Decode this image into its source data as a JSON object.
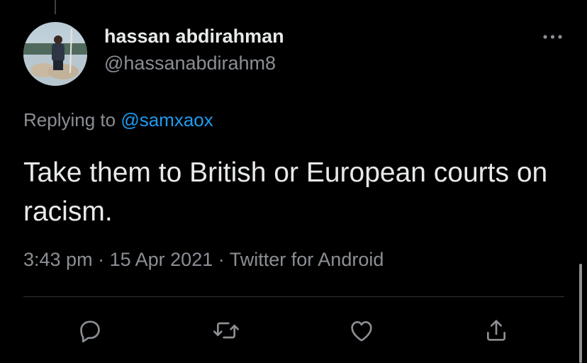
{
  "tweet": {
    "author": {
      "display_name": "hassan abdirahman",
      "handle": "@hassanabdirahm8",
      "avatar_icon": "profile-photo"
    },
    "reply_context": {
      "prefix": "Replying to",
      "mention": "@samxaox"
    },
    "text": "Take them to British or European courts on racism.",
    "meta": {
      "time": "3:43 pm",
      "date": "15 Apr 2021",
      "client": "Twitter for Android",
      "separator": "·"
    },
    "menu_icon": "more-horizontal-icon"
  },
  "actions": [
    {
      "name": "reply",
      "icon": "reply-icon"
    },
    {
      "name": "retweet",
      "icon": "retweet-icon"
    },
    {
      "name": "like",
      "icon": "heart-icon"
    },
    {
      "name": "share",
      "icon": "share-icon"
    }
  ],
  "colors": {
    "background": "#000000",
    "text_primary": "#e7e9ea",
    "text_secondary": "#8b8f94",
    "link": "#1d9bf0",
    "divider": "#2f3336"
  }
}
